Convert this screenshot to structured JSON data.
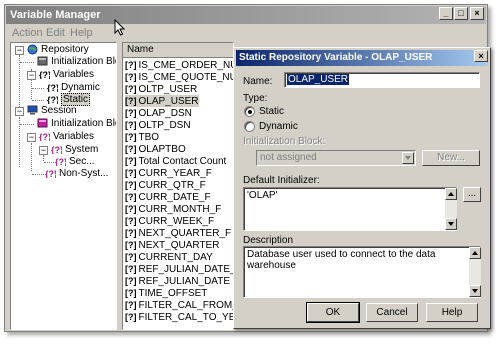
{
  "window": {
    "title": "Variable Manager",
    "controls": {
      "minimize": "_",
      "maximize": "□",
      "close": "×"
    }
  },
  "menu": [
    "Action",
    "Edit",
    "Help"
  ],
  "tree": {
    "repository": "Repository",
    "repo_init_blocks": "Initialization Blo...",
    "repo_variables": "Variables",
    "dynamic": "Dynamic",
    "static": "Static",
    "session": "Session",
    "session_init_blocks": "Initialization Blo...",
    "session_variables": "Variables",
    "system": "System",
    "security": "Sec...",
    "non_system": "Non-Syst..."
  },
  "list": {
    "header": "Name",
    "rows": [
      "IS_CME_ORDER_NUM",
      "IS_CME_QUOTE_NUM",
      "OLTP_USER",
      "OLAP_USER",
      "OLAP_DSN",
      "OLTP_DSN",
      "TBO",
      "OLAPTBO",
      "Total Contact Count",
      "CURR_YEAR_F",
      "CURR_QTR_F",
      "CURR_DATE_F",
      "CURR_MONTH_F",
      "CURR_WEEK_F",
      "NEXT_QUARTER_F",
      "NEXT_QUARTER",
      "CURRENT_DAY",
      "REF_JULIAN_DATE_NU",
      "REF_JULIAN_DATE",
      "TIME_OFFSET",
      "FILTER_CAL_FROM_YE",
      "FILTER_CAL_TO_YEAR"
    ],
    "selected": "OLAP_USER",
    "icon_glyph": "[?]"
  },
  "dialog": {
    "title": "Static Repository Variable - OLAP_USER",
    "close": "×",
    "name_label": "Name:",
    "name_value": "OLAP_USER",
    "type_label": "Type:",
    "type_static": "Static",
    "type_dynamic": "Dynamic",
    "init_block_label": "Initialization Block:",
    "init_block_value": "not assigned",
    "new_button": "New...",
    "default_init_label": "Default Initializer:",
    "default_init_value": "'OLAP'",
    "ellipsis_button": "...",
    "description_label": "Description",
    "description_value": "Database user used to connect to the data warehouse",
    "ok": "OK",
    "cancel": "Cancel",
    "help": "Help"
  }
}
